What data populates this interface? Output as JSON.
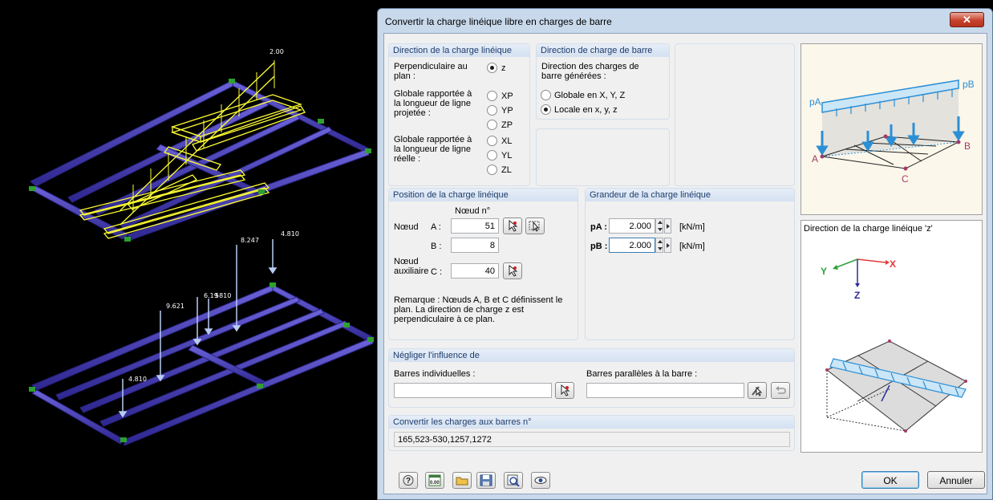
{
  "dialog": {
    "title": "Convertir la charge linéique libre en charges de barre",
    "close_glyph": "✕"
  },
  "direction_charge": {
    "header": "Direction de la charge linéique",
    "perp_label": "Perpendiculaire au plan :",
    "opt_z": "z",
    "glob_proj_label": "Globale rapportée à la longueur de ligne projetée :",
    "opt_xp": "XP",
    "opt_yp": "YP",
    "opt_zp": "ZP",
    "glob_reel_label": "Globale rapportée à la longueur de ligne réelle :",
    "opt_xl": "XL",
    "opt_yl": "YL",
    "opt_zl": "ZL",
    "selected": "z"
  },
  "direction_barre": {
    "header": "Direction de charge de barre",
    "desc": "Direction des charges de barre générées :",
    "opt_global": "Globale en X, Y, Z",
    "opt_local": "Locale en x, y, z",
    "selected": "local"
  },
  "position": {
    "header": "Position de la charge linéique",
    "col_header": "Nœud n°",
    "noeud_label": "Nœud",
    "aux_label": "Nœud auxiliaire",
    "a_label": "A :",
    "a_value": "51",
    "b_label": "B :",
    "b_value": "8",
    "c_label": "C :",
    "c_value": "40",
    "remark": "Remarque : Nœuds A, B et C définissent le plan. La direction de charge z est perpendiculaire à ce plan."
  },
  "grandeur": {
    "header": "Grandeur de la charge linéique",
    "pa_label": "pA :",
    "pa_value": "2.000",
    "pa_unit": "[kN/m]",
    "pb_label": "pB :",
    "pb_value": "2.000",
    "pb_unit": "[kN/m]"
  },
  "negliger": {
    "header": "Négliger l'influence de",
    "indiv_label": "Barres individuelles :",
    "indiv_value": "",
    "paral_label": "Barres parallèles à la barre :",
    "paral_value": ""
  },
  "convertir": {
    "header": "Convertir les charges aux barres n°",
    "value": "165,523-530,1257,1272"
  },
  "preview": {
    "top": {
      "pa": "pA",
      "pb": "pB",
      "a": "A",
      "b": "B",
      "c": "C"
    },
    "bottom": {
      "caption": "Direction de la charge linéique 'z'",
      "x": "X",
      "y": "Y",
      "z": "Z"
    }
  },
  "footer": {
    "ok": "OK",
    "cancel": "Annuler",
    "tools": [
      "help-icon",
      "units-icon",
      "open-icon",
      "save-icon",
      "zoom-icon",
      "view-icon"
    ],
    "units_text": "0.00"
  },
  "viewport": {
    "top_load_value": "2.00",
    "bottom_labels": [
      "8.247",
      "4.810",
      "9.621",
      "6.19",
      "5810",
      "4.810"
    ]
  },
  "colors": {
    "beam": "#3f37ae",
    "highlight": "#ffff33",
    "arrow": "#b8ccf2",
    "accent": "#1f3c6b",
    "preview_blue": "#2b8fd6"
  }
}
